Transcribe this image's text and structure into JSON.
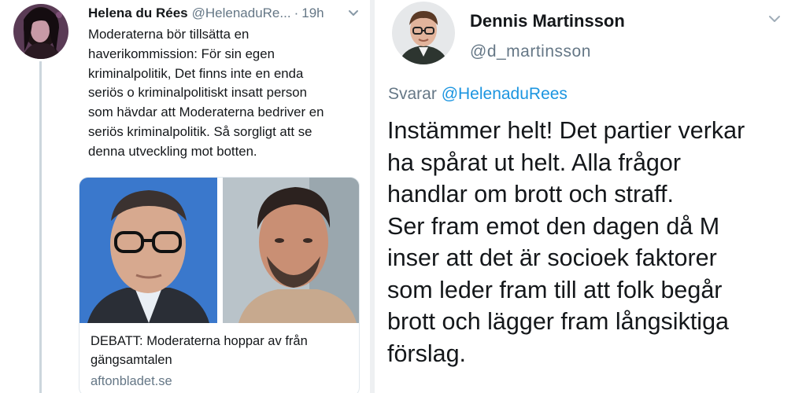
{
  "left_tweet": {
    "name": "Helena du Rées",
    "handle": "@HelenaduRe...",
    "separator": "·",
    "time": "19h",
    "text": "Moderaterna bör tillsätta en\nhaverikommission: För sin egen\nkriminalpolitik, Det finns inte en enda\nseriös o kriminalpolitiskt insatt person\nsom hävdar att Moderaterna bedriver en\nseriös kriminalpolitik. Så sorgligt att se\ndenna utveckling mot botten.",
    "card": {
      "title": "DEBATT: Moderaterna hoppar av från gängsamtalen",
      "domain": "aftonbladet.se"
    }
  },
  "right_tweet": {
    "name": "Dennis Martinsson",
    "handle": "@d_martinsson",
    "reply_prefix": "Svarar ",
    "reply_mention": "@HelenaduRees",
    "text": "Instämmer helt! Det partier verkar\nha spårat ut helt. Alla frågor\nhandlar om brott och straff.\nSer fram emot den dagen då M\ninser att det är socioek faktorer\nsom leder fram till att folk begår\nbrott och lägger fram långsiktiga\nförslag."
  },
  "icons": {
    "left_avatar": "profile-photo",
    "right_avatar": "profile-photo",
    "menu": "chevron-down-icon"
  },
  "colors": {
    "text": "#14171a",
    "secondary": "#657786",
    "link": "#1b95e0",
    "border": "#e1e8ed"
  }
}
